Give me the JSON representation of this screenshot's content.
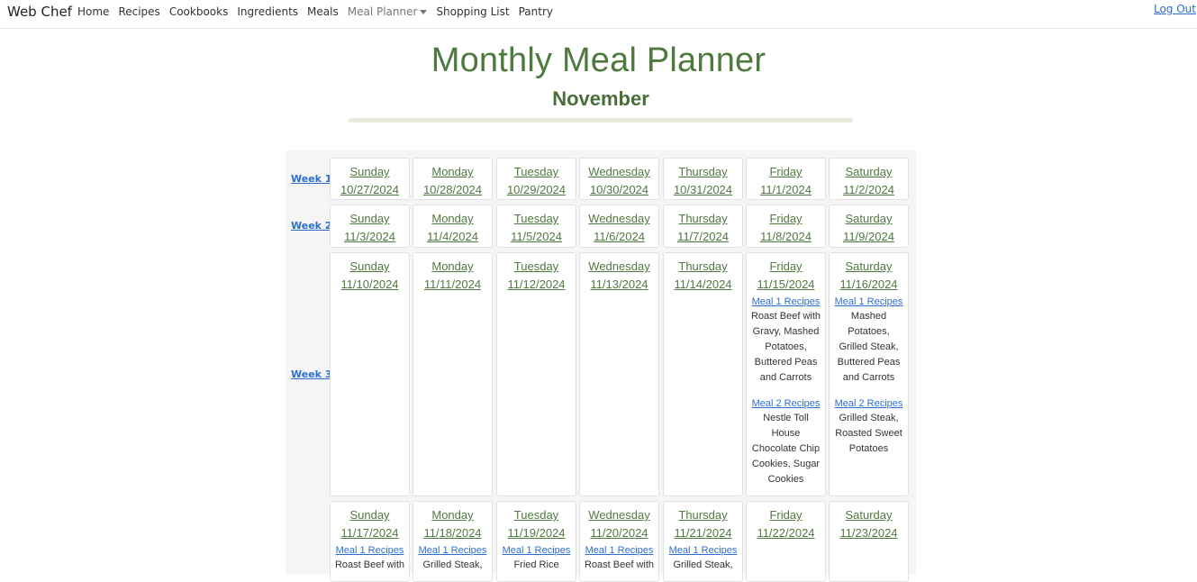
{
  "navbar": {
    "brand": "Web Chef",
    "links": [
      "Home",
      "Recipes",
      "Cookbooks",
      "Ingredients",
      "Meals"
    ],
    "meal_planner": "Meal Planner",
    "links_after": [
      "Shopping List",
      "Pantry"
    ],
    "logout": "Log Out"
  },
  "header": {
    "title": "Monthly Meal Planner",
    "month": "November"
  },
  "weeks": [
    {
      "label": "Week 1",
      "days": [
        {
          "name": "Sunday",
          "date": "10/27/2024"
        },
        {
          "name": "Monday",
          "date": "10/28/2024"
        },
        {
          "name": "Tuesday",
          "date": "10/29/2024"
        },
        {
          "name": "Wednesday",
          "date": "10/30/2024"
        },
        {
          "name": "Thursday",
          "date": "10/31/2024"
        },
        {
          "name": "Friday",
          "date": "11/1/2024"
        },
        {
          "name": "Saturday",
          "date": "11/2/2024"
        }
      ]
    },
    {
      "label": "Week 2",
      "days": [
        {
          "name": "Sunday",
          "date": "11/3/2024"
        },
        {
          "name": "Monday",
          "date": "11/4/2024"
        },
        {
          "name": "Tuesday",
          "date": "11/5/2024"
        },
        {
          "name": "Wednesday",
          "date": "11/6/2024"
        },
        {
          "name": "Thursday",
          "date": "11/7/2024"
        },
        {
          "name": "Friday",
          "date": "11/8/2024"
        },
        {
          "name": "Saturday",
          "date": "11/9/2024"
        }
      ]
    },
    {
      "label": "Week 3",
      "days": [
        {
          "name": "Sunday",
          "date": "11/10/2024"
        },
        {
          "name": "Monday",
          "date": "11/11/2024"
        },
        {
          "name": "Tuesday",
          "date": "11/12/2024"
        },
        {
          "name": "Wednesday",
          "date": "11/13/2024"
        },
        {
          "name": "Thursday",
          "date": "11/14/2024"
        },
        {
          "name": "Friday",
          "date": "11/15/2024",
          "meals": [
            {
              "link": "Meal 1 Recipes",
              "text": "Roast Beef with Gravy, Mashed Potatoes, Buttered Peas and Carrots"
            },
            {
              "link": "Meal 2 Recipes",
              "text": "Nestle Toll House Chocolate Chip Cookies, Sugar Cookies"
            }
          ]
        },
        {
          "name": "Saturday",
          "date": "11/16/2024",
          "meals": [
            {
              "link": "Meal 1 Recipes",
              "text": "Mashed Potatoes, Grilled Steak, Buttered Peas and Carrots"
            },
            {
              "link": "Meal 2 Recipes",
              "text": "Grilled Steak, Roasted Sweet Potatoes"
            }
          ]
        }
      ]
    },
    {
      "label": "",
      "days": [
        {
          "name": "Sunday",
          "date": "11/17/2024",
          "meals": [
            {
              "link": "Meal 1 Recipes",
              "text": "Roast Beef with"
            }
          ]
        },
        {
          "name": "Monday",
          "date": "11/18/2024",
          "meals": [
            {
              "link": "Meal 1 Recipes",
              "text": "Grilled Steak,"
            }
          ]
        },
        {
          "name": "Tuesday",
          "date": "11/19/2024",
          "meals": [
            {
              "link": "Meal 1 Recipes",
              "text": "Fried Rice"
            }
          ]
        },
        {
          "name": "Wednesday",
          "date": "11/20/2024",
          "meals": [
            {
              "link": "Meal 1 Recipes",
              "text": "Roast Beef with"
            }
          ]
        },
        {
          "name": "Thursday",
          "date": "11/21/2024",
          "meals": [
            {
              "link": "Meal 1 Recipes",
              "text": "Grilled Steak,"
            }
          ]
        },
        {
          "name": "Friday",
          "date": "11/22/2024"
        },
        {
          "name": "Saturday",
          "date": "11/23/2024"
        }
      ]
    }
  ]
}
